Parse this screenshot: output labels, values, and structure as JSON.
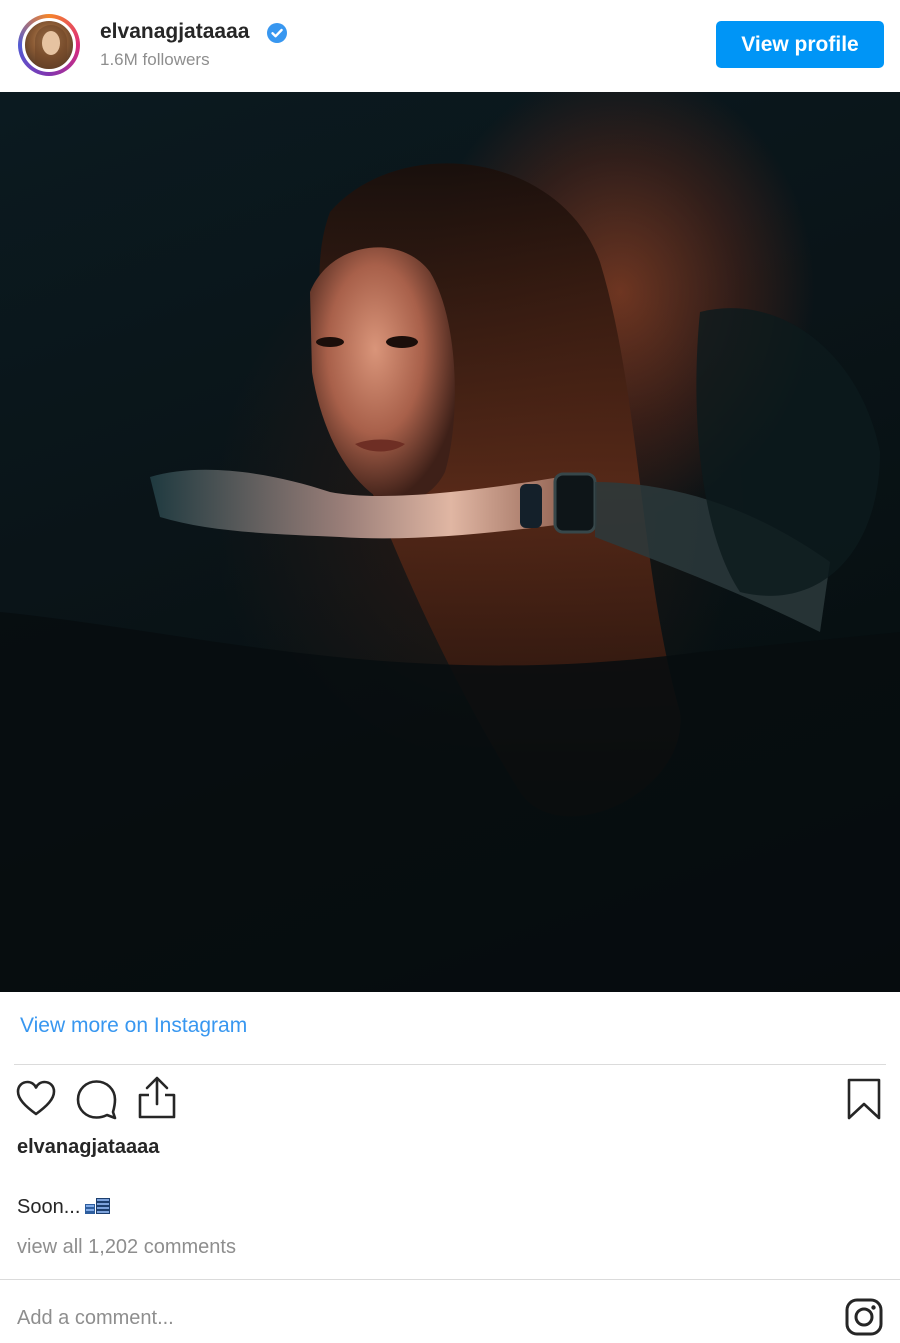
{
  "header": {
    "username": "elvanagjataaaa",
    "followers": "1.6M followers",
    "view_profile_label": "View profile"
  },
  "post": {
    "view_more_label": "View more on Instagram",
    "poster": "elvanagjataaaa",
    "caption": "Soon...",
    "comments_link": "view all 1,202 comments",
    "comment_placeholder": "Add a comment..."
  },
  "icons": {
    "like": "heart-icon",
    "comment": "comment-bubble-icon",
    "share": "share-icon",
    "save": "bookmark-icon",
    "brand": "instagram-logo-icon",
    "verified": "verified-badge-icon"
  },
  "colors": {
    "accent": "#0095f6",
    "link": "#3897f0",
    "text": "#262626",
    "muted": "#8e8e8e",
    "divider": "#dbdbdb"
  }
}
